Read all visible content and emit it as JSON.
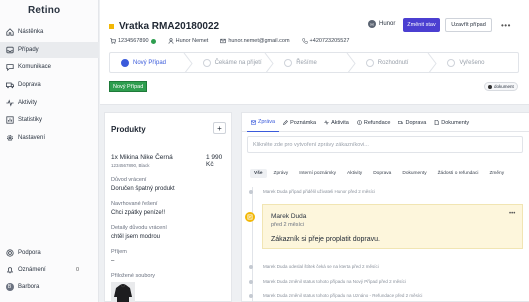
{
  "app": {
    "logo": "Retino"
  },
  "sidebar": {
    "items": [
      {
        "label": "Nástěnka",
        "icon": "home-icon"
      },
      {
        "label": "Případy",
        "icon": "inbox-icon"
      },
      {
        "label": "Komunikace",
        "icon": "chat-icon"
      },
      {
        "label": "Doprava",
        "icon": "truck-icon"
      },
      {
        "label": "Aktivity",
        "icon": "activity-icon"
      },
      {
        "label": "Statistiky",
        "icon": "chart-icon"
      },
      {
        "label": "Nastavení",
        "icon": "gear-icon"
      }
    ],
    "footer": {
      "support": "Podpora",
      "notifications": "Oznámení",
      "notifications_count": "0",
      "user": "Barbora",
      "user_initial": "B"
    }
  },
  "case": {
    "title": "Vratka RMA20180022",
    "order_number": "1234567890",
    "customer": "Hunor Nemet",
    "email": "hunor.nemet@gmail.com",
    "phone": "+420723205527",
    "assignee": "Hunor",
    "assignee_initial": "H",
    "change_state_label": "Změnit stav",
    "close_case_label": "Uzavřít případ",
    "more_label": "•••",
    "status_badge": "Nový Případ",
    "doc_chip": "dokument",
    "steps": [
      "Nový Případ",
      "Čekáme na přijetí",
      "Řešíme",
      "Rozhodnutí",
      "Vyřešeno"
    ]
  },
  "products": {
    "title": "Produkty",
    "add_label": "+",
    "item_name": "1x Mikina Nike Černá",
    "item_price": "1 990 Kč",
    "item_sub": "1234567890, Black",
    "fields": [
      {
        "label": "Důvod vrácení",
        "value": "Doručen špatný produkt"
      },
      {
        "label": "Navrhované řešení",
        "value": "Chci zpátky peníze!!"
      },
      {
        "label": "Detaily důvodu vrácení",
        "value": "chtěl jsem modrou"
      },
      {
        "label": "Příjem",
        "value": "–"
      },
      {
        "label": "Přiložené soubory",
        "value": ""
      }
    ]
  },
  "tabs": [
    {
      "label": "Zpráva",
      "icon": "mail-icon"
    },
    {
      "label": "Poznámka",
      "icon": "pencil-icon"
    },
    {
      "label": "Aktivita",
      "icon": "activity-icon"
    },
    {
      "label": "Refundace",
      "icon": "refund-icon"
    },
    {
      "label": "Doprava",
      "icon": "truck-icon"
    },
    {
      "label": "Dokumenty",
      "icon": "document-icon"
    }
  ],
  "compose": {
    "placeholder": "Klikněte zde pro vytvoření zprávy zákazníkovi..."
  },
  "filters": [
    "Vše",
    "Zprávy",
    "Interní poznámky",
    "Aktivity",
    "Doprava",
    "Dokumenty",
    "Žádosti o refundaci",
    "Změny"
  ],
  "timeline": {
    "top_event": "Marek Duda případ přidělil uživateli Hunor před 2 měsíci",
    "message": {
      "author": "Marek Duda",
      "time": "před 2 měsíci",
      "text": "Zákazník si přeje proplatit dopravu.",
      "more": "•••"
    },
    "events": [
      "Marek Duda odeslal štítek čeká se na kterta před 2 měsíci",
      "Marek Duda změnil status tohoto případu na Nový Případ před 2 měsíci",
      "Marek Duda změnil status tohoto případu na Uznáno - Refundace před 2 měsíci"
    ]
  },
  "colors": {
    "accent": "#4b3fd1",
    "status_green": "#2e9e4f",
    "title_dot": "#f2b705",
    "step_active": "#3b5bdb"
  }
}
